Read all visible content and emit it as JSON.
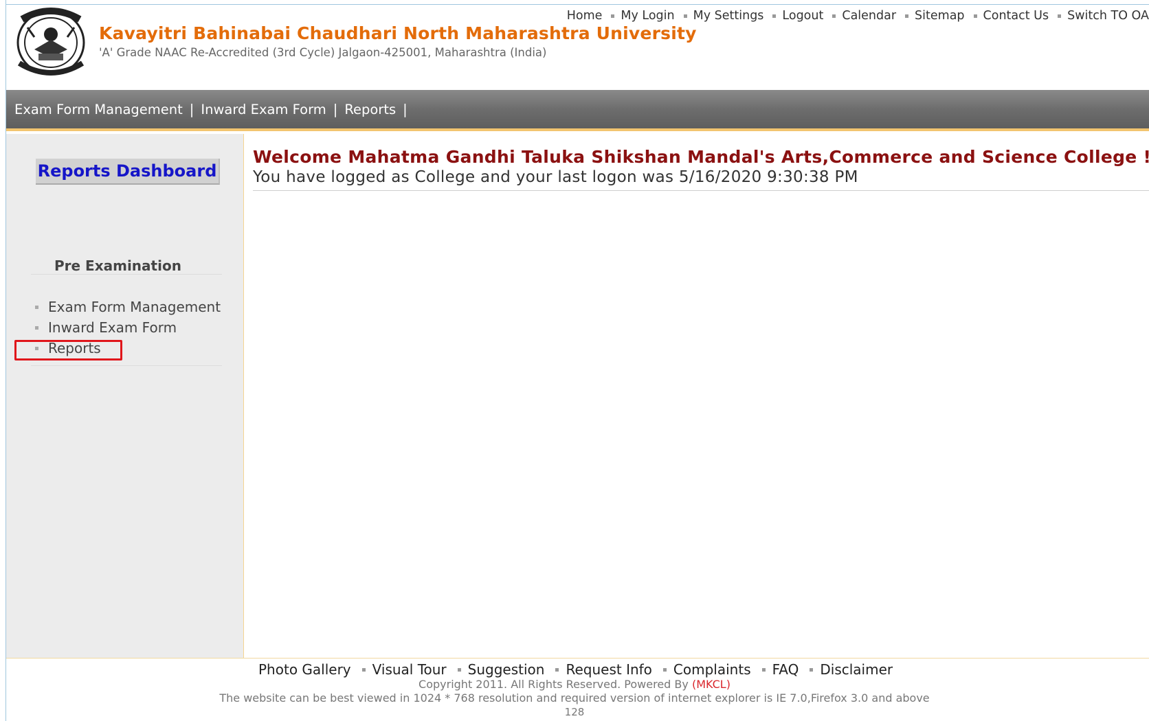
{
  "header": {
    "university_name": "Kavayitri Bahinabai Chaudhari North Maharashtra University",
    "subtitle": "'A' Grade NAAC Re-Accredited (3rd Cycle) Jalgaon-425001, Maharashtra (India)",
    "logo_icon": "university-seal-icon",
    "top_links": [
      "Home",
      "My Login",
      "My Settings",
      "Logout",
      "Calendar",
      "Sitemap",
      "Contact Us",
      "Switch TO OA"
    ]
  },
  "navbar": {
    "items": [
      "Exam Form Management",
      "Inward Exam Form",
      "Reports"
    ],
    "separator": "|"
  },
  "sidebar": {
    "dashboard_button": "Reports Dashboard",
    "section_title": "Pre Examination",
    "items": [
      "Exam Form Management",
      "Inward Exam Form",
      "Reports"
    ],
    "highlighted_item": "Reports",
    "highlight_color": "#e0161b"
  },
  "main": {
    "welcome": "Welcome Mahatma Gandhi Taluka Shikshan Mandal's Arts,Commerce and Science College !",
    "last_logon": "You have logged as College and your last logon was 5/16/2020 9:30:38 PM"
  },
  "footer": {
    "links": [
      "Photo Gallery",
      "Visual Tour",
      "Suggestion",
      "Request Info",
      "Complaints",
      "FAQ",
      "Disclaimer"
    ],
    "copyright_prefix": "Copyright 2011. All Rights Reserved. Powered By",
    "powered_by": "(MKCL)",
    "view_note": "The website can be best viewed in 1024 * 768 resolution and required version of internet explorer is IE 7.0,Firefox 3.0 and above",
    "counter": "128"
  },
  "colors": {
    "brand_orange": "#e36c0a",
    "welcome_red": "#8b1111",
    "dashboard_blue": "#1515c8",
    "navbar_gray": "#6d6d6d"
  }
}
